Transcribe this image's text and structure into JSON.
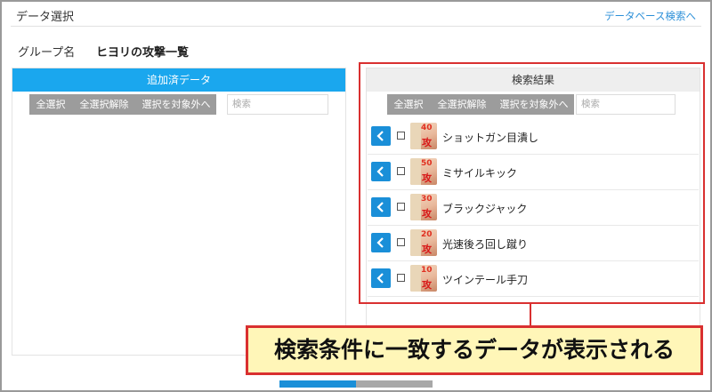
{
  "header": {
    "title": "データ選択",
    "db_search_link": "データベース検索へ"
  },
  "group": {
    "label": "グループ名",
    "name": "ヒヨリの攻撃一覧"
  },
  "left_panel": {
    "title": "追加済データ",
    "toolbar": {
      "select_all": "全選択",
      "deselect_all": "全選択解除",
      "exclude_selected": "選択を対象外へ",
      "search_placeholder": "検索"
    }
  },
  "right_panel": {
    "title": "検索結果",
    "toolbar": {
      "select_all": "全選択",
      "deselect_all": "全選択解除",
      "exclude_selected": "選択を対象外へ",
      "search_placeholder": "検索"
    },
    "results": [
      {
        "name": "ショットガン目潰し",
        "badge": "40",
        "badge_kanji": "攻"
      },
      {
        "name": "ミサイルキック",
        "badge": "50",
        "badge_kanji": "攻"
      },
      {
        "name": "ブラックジャック",
        "badge": "30",
        "badge_kanji": "攻"
      },
      {
        "name": "光速後ろ回し蹴り",
        "badge": "20",
        "badge_kanji": "攻"
      },
      {
        "name": "ツインテール手刀",
        "badge": "10",
        "badge_kanji": "攻"
      }
    ]
  },
  "callout": {
    "text": "検索条件に一致するデータが表示される"
  },
  "colors": {
    "accent": "#1aa7ee",
    "button_blue": "#1a8fd8",
    "highlight_red": "#d93030",
    "callout_bg": "#fff6b8"
  },
  "icons": {
    "row_action": "chevron-left-icon"
  }
}
